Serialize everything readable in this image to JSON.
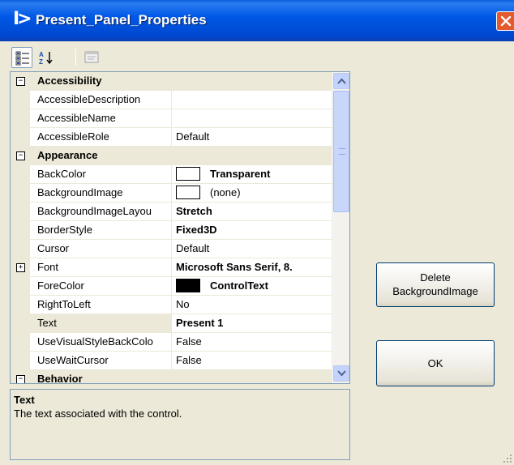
{
  "window": {
    "title_glyph": "I>",
    "title": "Present_Panel_Properties"
  },
  "toolbar": {
    "buttons": [
      {
        "icon": "categorized-icon",
        "active": true
      },
      {
        "icon": "alphabetical-sort-icon",
        "active": false
      },
      {
        "icon": "property-pages-icon",
        "active": false
      }
    ]
  },
  "property_grid": {
    "rows": [
      {
        "type": "category",
        "label": "Accessibility",
        "expander": "−"
      },
      {
        "type": "property",
        "name": "AccessibleDescription",
        "value": ""
      },
      {
        "type": "property",
        "name": "AccessibleName",
        "value": ""
      },
      {
        "type": "property",
        "name": "AccessibleRole",
        "value": "Default"
      },
      {
        "type": "category",
        "label": "Appearance",
        "expander": "−"
      },
      {
        "type": "property",
        "name": "BackColor",
        "value": "Transparent",
        "bold": true,
        "swatch": "#ffffff"
      },
      {
        "type": "property",
        "name": "BackgroundImage",
        "value": "(none)",
        "swatch": "#ffffff"
      },
      {
        "type": "property",
        "name": "BackgroundImageLayou",
        "value": "Stretch",
        "bold": true
      },
      {
        "type": "property",
        "name": "BorderStyle",
        "value": "Fixed3D",
        "bold": true
      },
      {
        "type": "property",
        "name": "Cursor",
        "value": "Default"
      },
      {
        "type": "property",
        "name": "Font",
        "value": "Microsoft Sans Serif, 8.",
        "bold": true,
        "expander": "+"
      },
      {
        "type": "property",
        "name": "ForeColor",
        "value": "ControlText",
        "bold": true,
        "swatch": "#000000"
      },
      {
        "type": "property",
        "name": "RightToLeft",
        "value": "No"
      },
      {
        "type": "property",
        "name": "Text",
        "value": "Present 1",
        "bold": true,
        "selected": true
      },
      {
        "type": "property",
        "name": "UseVisualStyleBackColo",
        "value": "False"
      },
      {
        "type": "property",
        "name": "UseWaitCursor",
        "value": "False"
      },
      {
        "type": "category",
        "label": "Behavior",
        "expander": "−"
      }
    ]
  },
  "description": {
    "title": "Text",
    "text": "The text associated with the control."
  },
  "buttons": {
    "delete_line1": "Delete",
    "delete_line2": "BackgroundImage",
    "ok": "OK"
  },
  "colors": {
    "titlebar": "#0058e6",
    "panel": "#ece9d8",
    "close": "#e35a2e"
  }
}
